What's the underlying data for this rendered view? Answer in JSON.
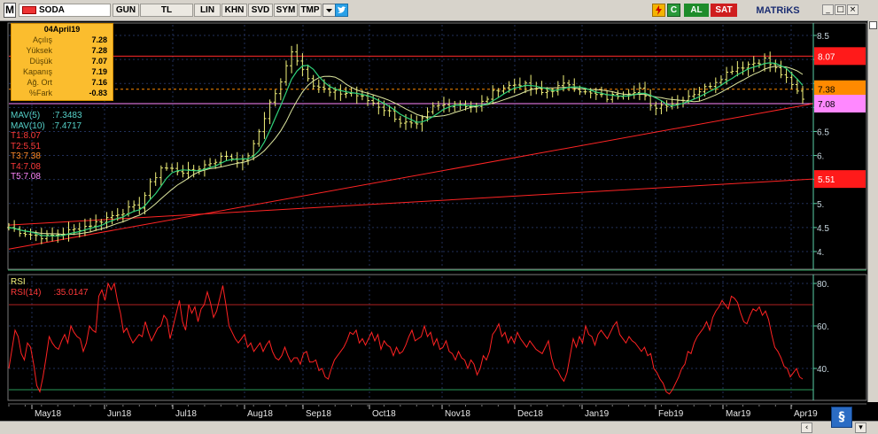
{
  "toolbar": {
    "logo": "M",
    "symbol": "SODA",
    "buttons": [
      "GUN",
      "TL",
      "LIN",
      "KHN",
      "SVD",
      "SYM",
      "TMP"
    ],
    "al_label": "AL",
    "sat_label": "SAT",
    "brand": "MATRiKS",
    "refresh_label": "C",
    "window_buttons": [
      "_",
      "□",
      "×"
    ]
  },
  "info_box": {
    "date": "04April19",
    "rows": [
      {
        "label": "Açılış",
        "value": "7.28"
      },
      {
        "label": "Yüksek",
        "value": "7.28"
      },
      {
        "label": "Düşük",
        "value": "7.07"
      },
      {
        "label": "Kapanış",
        "value": "7.19"
      },
      {
        "label": "Ağ. Ort",
        "value": "7.16"
      },
      {
        "label": "%Fark",
        "value": "-0.83"
      }
    ]
  },
  "legend": {
    "mav5": {
      "label": "MAV(5)",
      "value": ":7.3483"
    },
    "mav10": {
      "label": "MAV(10)",
      "value": ":7.4717"
    },
    "trend_lines": [
      "T1:8.07",
      "T2:5.51",
      "T3:7.38",
      "T4:7.08",
      "T5:7.08"
    ]
  },
  "price_tags": [
    {
      "value": "8.07",
      "bg": "#ff1a1a",
      "fg": "#ffffff"
    },
    {
      "value": "7.38",
      "bg": "#ff8a00",
      "fg": "#000000"
    },
    {
      "value": "7.08",
      "bg": "#ff88ff",
      "fg": "#000000"
    },
    {
      "value": "5.51",
      "bg": "#ff1a1a",
      "fg": "#ffffff"
    }
  ],
  "rsi": {
    "title": "RSI",
    "label": "RSI(14)",
    "value": ":35.0147",
    "axis_ticks": [
      "80.",
      "60.",
      "40."
    ]
  },
  "colors": {
    "bars": "#f2f27a",
    "mav5": "#2fd27a",
    "mav10": "#dfe8a0",
    "rsi": "#ff2222",
    "trend": "#ff2424",
    "axis": "#5ad0a8"
  },
  "chart_data": [
    {
      "type": "ohlc",
      "title": "SODA",
      "y_ticks": [
        "8.5",
        "8.",
        "7.5",
        "7.",
        "6.5",
        "6.",
        "5.5",
        "5.",
        "4.5",
        "4."
      ],
      "ylim": [
        3.8,
        8.7
      ],
      "x_months": [
        "May18",
        "Jun18",
        "Jul18",
        "Aug18",
        "Sep18",
        "Oct18",
        "Nov18",
        "Dec18",
        "Jan19",
        "Feb19",
        "Mar19",
        "Apr19"
      ],
      "price_path": [
        [
          0,
          4.5
        ],
        [
          4,
          4.35
        ],
        [
          7,
          4.3
        ],
        [
          12,
          4.45
        ],
        [
          16,
          4.6
        ],
        [
          20,
          4.8
        ],
        [
          24,
          4.95
        ],
        [
          26,
          5.4
        ],
        [
          28,
          5.75
        ],
        [
          33,
          5.65
        ],
        [
          38,
          5.9
        ],
        [
          40,
          6.0
        ],
        [
          43,
          5.85
        ],
        [
          45,
          6.2
        ],
        [
          48,
          7.1
        ],
        [
          50,
          7.5
        ],
        [
          52,
          8.2
        ],
        [
          54,
          7.8
        ],
        [
          56,
          7.5
        ],
        [
          59,
          7.3
        ],
        [
          63,
          7.3
        ],
        [
          67,
          7.1
        ],
        [
          70,
          6.9
        ],
        [
          72,
          6.7
        ],
        [
          75,
          6.6
        ],
        [
          78,
          7.0
        ],
        [
          82,
          7.1
        ],
        [
          86,
          7.0
        ],
        [
          90,
          7.4
        ],
        [
          94,
          7.5
        ],
        [
          98,
          7.3
        ],
        [
          103,
          7.5
        ],
        [
          106,
          7.3
        ],
        [
          110,
          7.2
        ],
        [
          116,
          7.4
        ],
        [
          118,
          7.0
        ],
        [
          122,
          7.1
        ],
        [
          128,
          7.4
        ],
        [
          133,
          7.8
        ],
        [
          139,
          8.0
        ],
        [
          142,
          7.7
        ],
        [
          144,
          7.45
        ],
        [
          146,
          7.2
        ]
      ],
      "series": [
        {
          "name": "MAV(5)",
          "last": 7.3483
        },
        {
          "name": "MAV(10)",
          "last": 7.4717
        }
      ],
      "horizontal_lines": [
        {
          "name": "T1",
          "value": 8.07,
          "style": "solid"
        },
        {
          "name": "T3",
          "value": 7.38,
          "style": "dashed"
        },
        {
          "name": "T4/T5",
          "value": 7.08,
          "style": "solid"
        }
      ],
      "trend_lines": [
        {
          "from": [
            0,
            4.05
          ],
          "to": [
            146,
            7.08
          ]
        },
        {
          "from": [
            0,
            4.55
          ],
          "to": [
            146,
            5.51
          ]
        }
      ]
    },
    {
      "type": "line",
      "title": "RSI(14)",
      "y_ticks": [
        "80.",
        "60.",
        "40."
      ],
      "ylim": [
        25,
        85
      ],
      "levels": [
        70,
        30
      ],
      "last": 35.0147,
      "values": [
        40,
        49,
        58,
        55,
        47,
        44,
        52,
        50,
        42,
        32,
        29,
        36,
        45,
        55,
        52,
        50,
        49,
        53,
        56,
        52,
        60,
        57,
        55,
        54,
        48,
        52,
        60,
        58,
        57,
        74,
        77,
        72,
        80,
        77,
        80,
        72,
        66,
        57,
        59,
        55,
        52,
        54,
        56,
        55,
        62,
        57,
        53,
        56,
        59,
        60,
        65,
        63,
        54,
        60,
        66,
        72,
        62,
        58,
        70,
        66,
        69,
        62,
        68,
        70,
        76,
        71,
        64,
        67,
        73,
        79,
        70,
        60,
        57,
        54,
        52,
        54,
        56,
        50,
        52,
        48,
        50,
        52,
        48,
        51,
        53,
        48,
        45,
        44,
        46,
        50,
        46,
        43,
        45,
        45,
        42,
        47,
        48,
        43,
        43,
        44,
        39,
        40,
        36,
        35,
        40,
        44,
        46,
        48,
        50,
        53,
        57,
        56,
        58,
        52,
        54,
        51,
        54,
        57,
        53,
        56,
        49,
        53,
        51,
        50,
        46,
        50,
        47,
        48,
        51,
        55,
        58,
        53,
        54,
        55,
        60,
        55,
        57,
        51,
        54,
        49,
        50,
        53,
        48,
        47,
        44,
        48,
        45,
        44,
        40,
        44,
        42,
        37,
        40,
        46,
        44,
        48,
        56,
        58,
        61,
        55,
        57,
        52,
        55,
        52,
        57,
        54,
        52,
        50,
        53,
        51,
        49,
        48,
        47,
        50,
        53,
        45,
        40,
        39,
        36,
        34,
        38,
        46,
        54,
        50,
        55,
        52,
        60,
        56,
        55,
        51,
        56,
        58,
        56,
        54,
        57,
        60,
        62,
        56,
        54,
        52,
        55,
        53,
        52,
        50,
        48,
        50,
        46,
        47,
        40,
        38,
        35,
        33,
        29,
        28,
        30,
        33,
        36,
        40,
        42,
        48,
        47,
        52,
        55,
        57,
        59,
        62,
        58,
        64,
        67,
        69,
        72,
        70,
        68,
        74,
        73,
        71,
        66,
        62,
        61,
        65,
        68,
        67,
        69,
        65,
        67,
        63,
        56,
        50,
        48,
        45,
        41,
        40,
        36,
        38,
        40,
        36,
        35
      ]
    }
  ]
}
